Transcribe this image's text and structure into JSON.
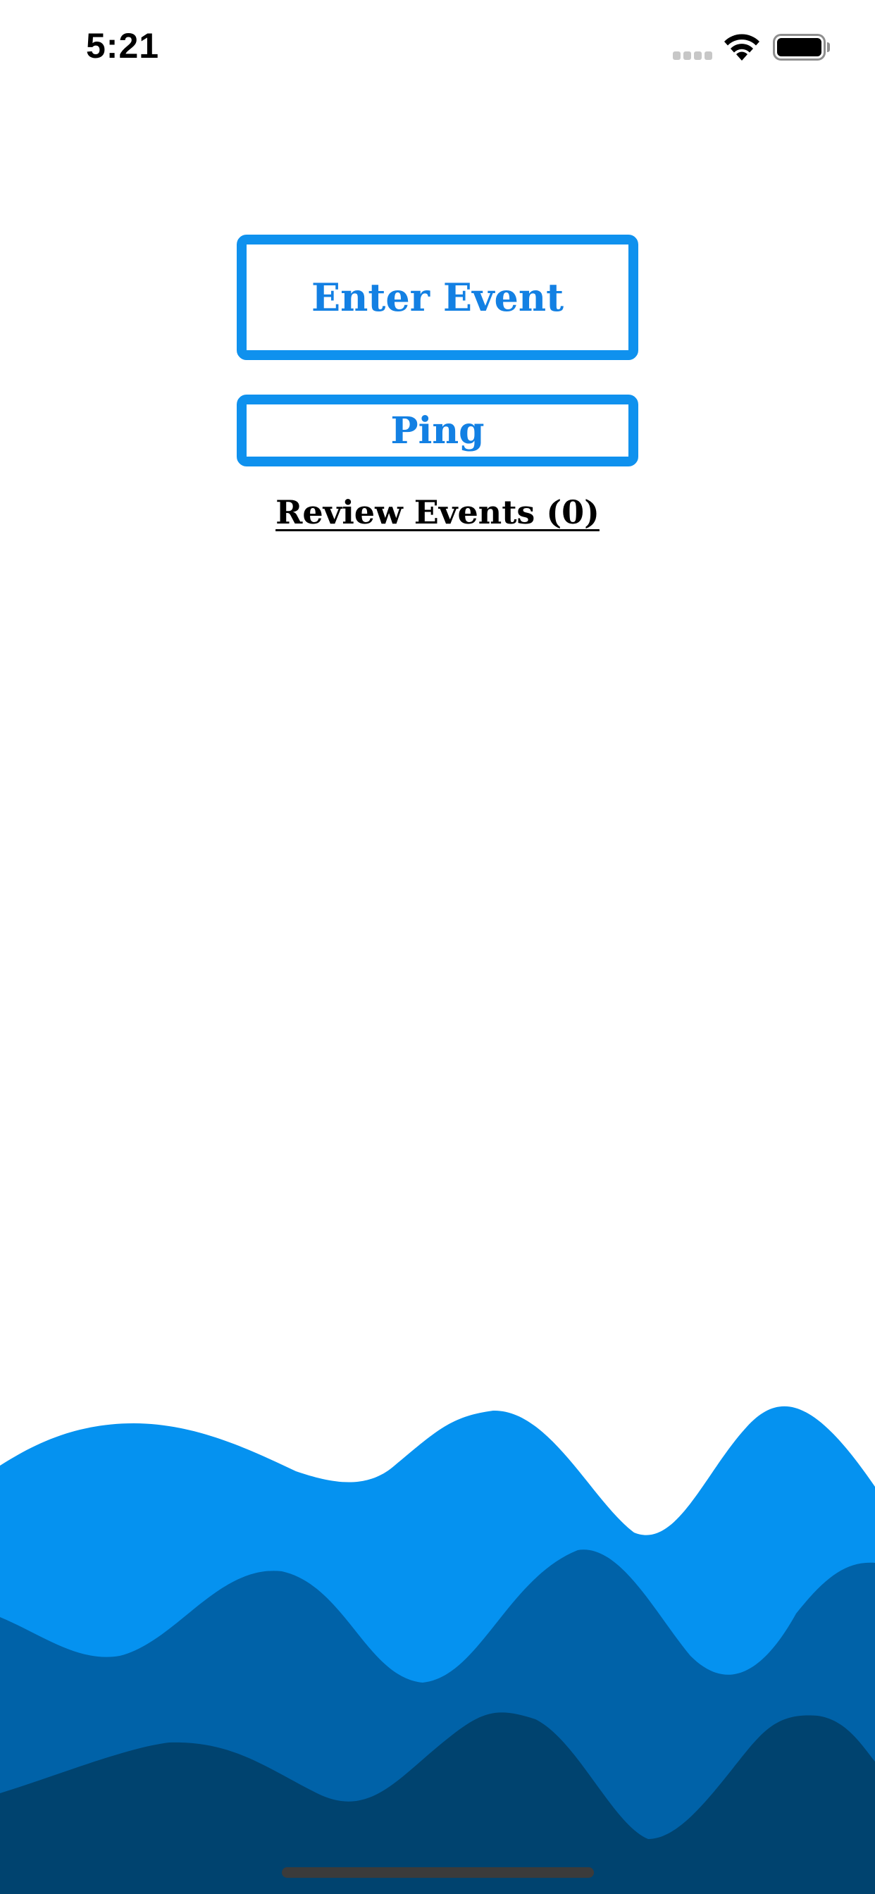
{
  "status_bar": {
    "time": "5:21"
  },
  "buttons": {
    "enter_event": "Enter Event",
    "ping": "Ping"
  },
  "review_link": "Review Events (0)",
  "colors": {
    "accent": "#0f91ee",
    "button_text": "#1380e3",
    "wave_light": "#0592f0",
    "wave_mid": "#0062a8",
    "wave_dark": "#00436f"
  }
}
